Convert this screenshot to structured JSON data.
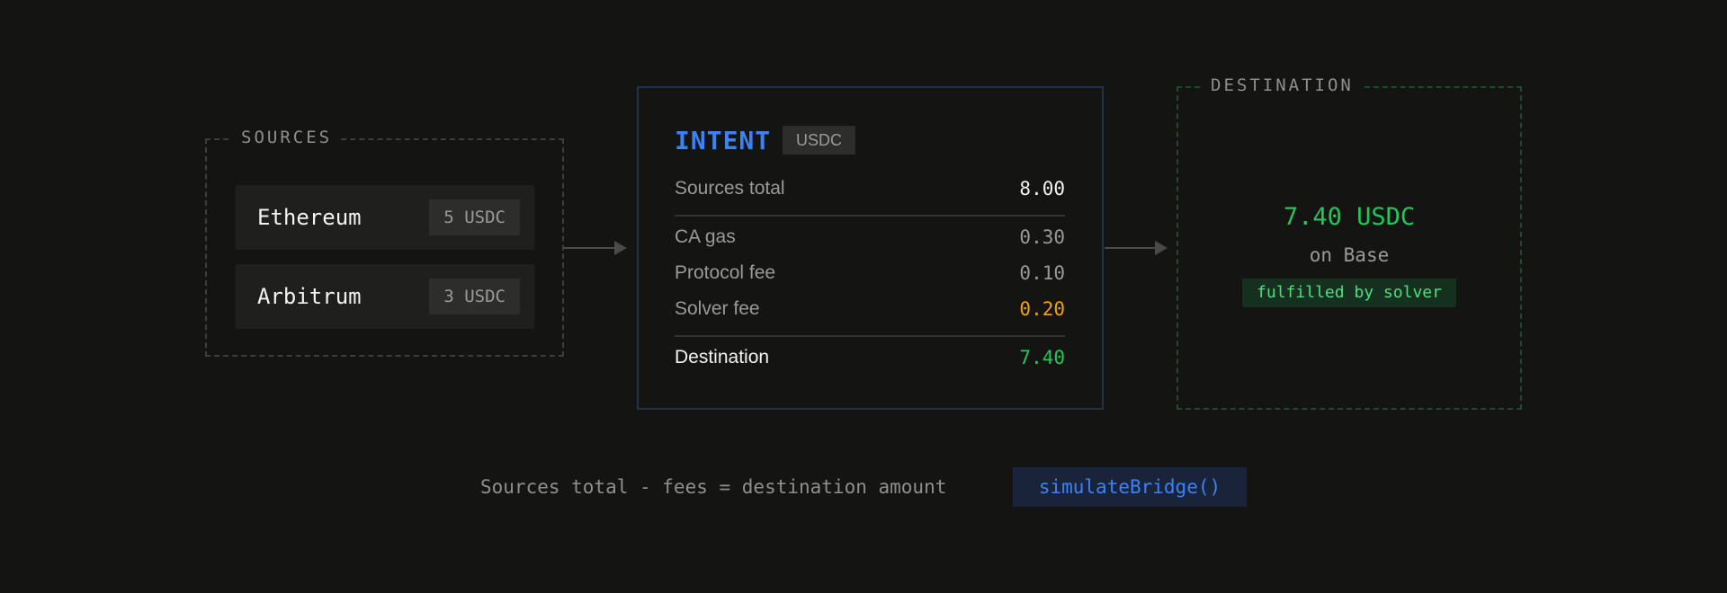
{
  "sources": {
    "label": "SOURCES",
    "items": [
      {
        "chain": "Ethereum",
        "amount": "5 USDC"
      },
      {
        "chain": "Arbitrum",
        "amount": "3 USDC"
      }
    ]
  },
  "intent": {
    "title": "INTENT",
    "token": "USDC",
    "sources_total": {
      "label": "Sources total",
      "value": "8.00"
    },
    "fees": [
      {
        "label": "CA gas",
        "value": "0.30"
      },
      {
        "label": "Protocol fee",
        "value": "0.10"
      },
      {
        "label": "Solver fee",
        "value": "0.20"
      }
    ],
    "destination": {
      "label": "Destination",
      "value": "7.40"
    }
  },
  "destination": {
    "label": "DESTINATION",
    "amount": "7.40 USDC",
    "chain": "on Base",
    "status": "fulfilled by solver"
  },
  "footer": {
    "formula": "Sources total - fees = destination amount",
    "function": "simulateBridge()"
  },
  "colors": {
    "accent_blue": "#3b82f6",
    "success_green": "#22c55e",
    "warning_orange": "#f59e0b"
  }
}
